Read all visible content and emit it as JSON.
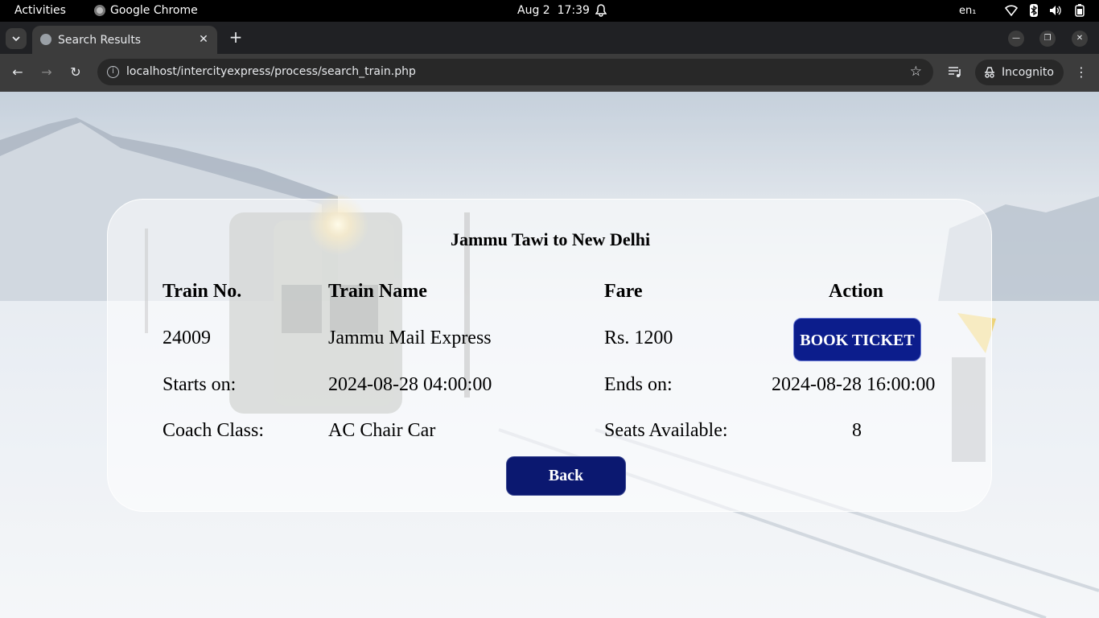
{
  "system_bar": {
    "activities": "Activities",
    "app_name": "Google Chrome",
    "date": "Aug 2",
    "time": "17:39",
    "language": "en₁"
  },
  "browser": {
    "tab_title": "Search Results",
    "url": "localhost/intercityexpress/process/search_train.php",
    "incognito_label": "Incognito"
  },
  "page": {
    "route_title": "Jammu Tawi to New Delhi",
    "headers": {
      "train_no": "Train No.",
      "train_name": "Train Name",
      "fare": "Fare",
      "action": "Action"
    },
    "train": {
      "number": "24009",
      "name": "Jammu Mail Express",
      "fare": "Rs. 1200"
    },
    "book_button": "BOOK TICKET",
    "starts_label": "Starts on:",
    "starts_value": "2024-08-28 04:00:00",
    "ends_label": "Ends on:",
    "ends_value": "2024-08-28 16:00:00",
    "coach_label": "Coach Class:",
    "coach_value": "AC Chair Car",
    "seats_label": "Seats Available:",
    "seats_value": "8",
    "back_button": "Back"
  },
  "colors": {
    "book_button_bg": "#0c1d8c",
    "back_button_bg": "#0b1870",
    "browser_chrome": "#3c3c3c"
  }
}
